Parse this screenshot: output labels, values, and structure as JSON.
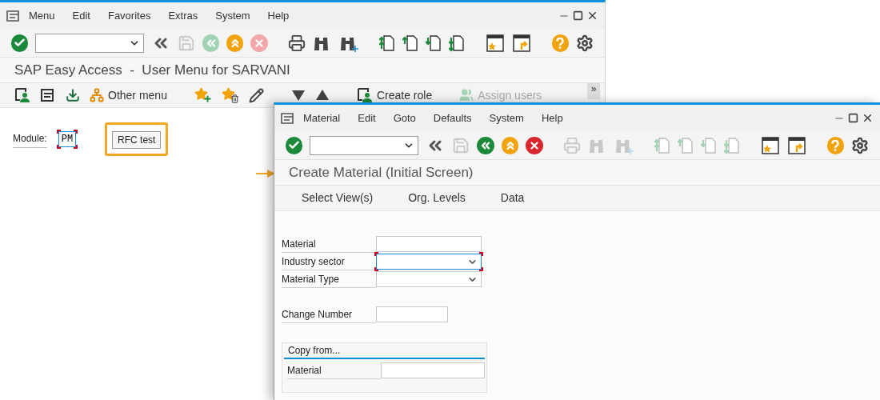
{
  "main_window": {
    "menu": [
      {
        "label": "Menu"
      },
      {
        "label": "Edit"
      },
      {
        "label": "Favorites"
      },
      {
        "label": "Extras"
      },
      {
        "label": "System"
      },
      {
        "label": "Help"
      }
    ],
    "toolbar": [
      {
        "kind": "enter",
        "disabled": false
      },
      {
        "kind": "command-field"
      },
      {
        "kind": "collapse",
        "disabled": false
      },
      {
        "kind": "save",
        "disabled": true
      },
      {
        "kind": "back",
        "disabled": true
      },
      {
        "kind": "exit",
        "disabled": false
      },
      {
        "kind": "cancel",
        "disabled": true
      },
      {
        "kind": "sep"
      },
      {
        "kind": "print",
        "disabled": false
      },
      {
        "kind": "find",
        "disabled": false
      },
      {
        "kind": "find-next",
        "disabled": false
      },
      {
        "kind": "sep"
      },
      {
        "kind": "first-page",
        "disabled": false
      },
      {
        "kind": "prev-page",
        "disabled": false
      },
      {
        "kind": "next-page",
        "disabled": false
      },
      {
        "kind": "last-page",
        "disabled": false
      },
      {
        "kind": "sep"
      },
      {
        "kind": "new-session",
        "disabled": false
      },
      {
        "kind": "shortcut",
        "disabled": false
      },
      {
        "kind": "sep"
      },
      {
        "kind": "help",
        "disabled": false
      },
      {
        "kind": "settings",
        "disabled": false
      }
    ],
    "title": "SAP Easy Access  -  User Menu for SARVANI",
    "app_toolbar": [
      {
        "kind": "user-doc",
        "disabled": false
      },
      {
        "kind": "menu-doc",
        "disabled": false
      },
      {
        "kind": "download",
        "disabled": false
      },
      {
        "kind": "hierarchy",
        "label": "Other menu",
        "disabled": false
      },
      {
        "kind": "sep"
      },
      {
        "kind": "star-add",
        "disabled": false
      },
      {
        "kind": "star-delete",
        "disabled": false
      },
      {
        "kind": "pencil",
        "disabled": false
      },
      {
        "kind": "sep"
      },
      {
        "kind": "triangle-down",
        "disabled": false
      },
      {
        "kind": "triangle-up",
        "disabled": false
      },
      {
        "kind": "sep"
      },
      {
        "kind": "user-doc",
        "label": "Create role",
        "disabled": false
      },
      {
        "kind": "sep"
      },
      {
        "kind": "users",
        "label": "Assign users",
        "disabled": true
      }
    ],
    "more_button": "»",
    "module": {
      "label": "Module:",
      "value": "PM",
      "focused": true
    },
    "rfc_button": {
      "label": "RFC test",
      "highlighted": true
    }
  },
  "material_window": {
    "menu": [
      {
        "label": "Material"
      },
      {
        "label": "Edit"
      },
      {
        "label": "Goto"
      },
      {
        "label": "Defaults"
      },
      {
        "label": "System"
      },
      {
        "label": "Help"
      }
    ],
    "toolbar": [
      {
        "kind": "enter",
        "disabled": false
      },
      {
        "kind": "command-field"
      },
      {
        "kind": "collapse",
        "disabled": false
      },
      {
        "kind": "save",
        "disabled": true
      },
      {
        "kind": "back",
        "disabled": false
      },
      {
        "kind": "exit",
        "disabled": false
      },
      {
        "kind": "cancel",
        "disabled": false
      },
      {
        "kind": "sep"
      },
      {
        "kind": "print",
        "disabled": true
      },
      {
        "kind": "find",
        "disabled": true
      },
      {
        "kind": "find-next",
        "disabled": true
      },
      {
        "kind": "sep"
      },
      {
        "kind": "first-page",
        "disabled": true
      },
      {
        "kind": "prev-page",
        "disabled": true
      },
      {
        "kind": "next-page",
        "disabled": true
      },
      {
        "kind": "last-page",
        "disabled": true
      },
      {
        "kind": "sep"
      },
      {
        "kind": "new-session",
        "disabled": false
      },
      {
        "kind": "shortcut",
        "disabled": false
      },
      {
        "kind": "sep"
      },
      {
        "kind": "help",
        "disabled": false
      },
      {
        "kind": "settings",
        "disabled": false
      }
    ],
    "title": "Create Material (Initial Screen)",
    "title_pointer": true,
    "app_toolbar": [
      {
        "label": "Select View(s)"
      },
      {
        "label": "Org. Levels"
      },
      {
        "label": "Data"
      }
    ],
    "fields": [
      {
        "label": "Material",
        "kind": "text",
        "focused": false
      },
      {
        "label": "Industry sector",
        "kind": "dropdown",
        "focused": true
      },
      {
        "label": "Material Type",
        "kind": "dropdown",
        "focused": false
      }
    ],
    "change_number": {
      "label": "Change Number",
      "kind": "text",
      "focused": false
    },
    "copy_from": {
      "title": "Copy from...",
      "fields": [
        {
          "label": "Material",
          "kind": "text",
          "focused": false
        }
      ]
    }
  }
}
